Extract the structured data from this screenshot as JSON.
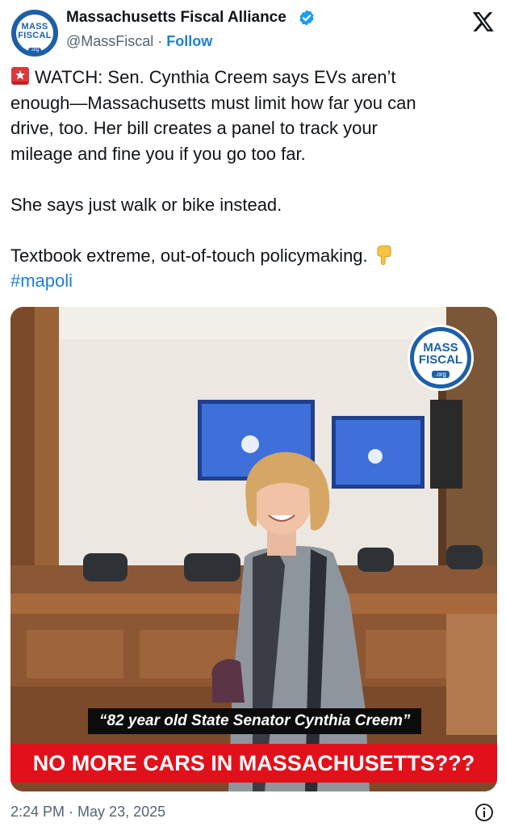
{
  "author": {
    "avatar_text_line1": "MASS",
    "avatar_text_line2": "FISCAL",
    "avatar_text_org": ".org",
    "name": "Massachusetts Fiscal Alliance",
    "handle": "@MassFiscal",
    "separator": " · ",
    "follow_label": "Follow",
    "verified_icon": "verified-badge-icon",
    "brand_color": "#1d5fa8"
  },
  "platform_icon": "x-logo-icon",
  "tweet": {
    "siren_icon": "siren-emoji-icon",
    "lines": [
      "WATCH: Sen. Cynthia Creem says EVs aren’t",
      "enough—Massachusetts must limit how far you can",
      "drive, too. Her bill creates a panel to track your",
      "mileage and fine you if you go too far."
    ],
    "line2": "She says just walk or bike instead.",
    "line3": "Textbook extreme, out-of-touch policymaking.",
    "pointer_icon": "pointing-down-emoji-icon",
    "hashtag": "#mapoli",
    "link_color": "#1d7fd6"
  },
  "media": {
    "watermark_line1": "MASS",
    "watermark_line2": "FISCAL",
    "watermark_org": ".org",
    "caption": "“82 year old State Senator Cynthia Creem”",
    "banner": "NO MORE CARS IN MASSACHUSETTS???",
    "banner_color": "#e0111b"
  },
  "footer": {
    "time": "2:24 PM",
    "separator": " · ",
    "date": "May 23, 2025",
    "info_icon": "info-icon"
  }
}
